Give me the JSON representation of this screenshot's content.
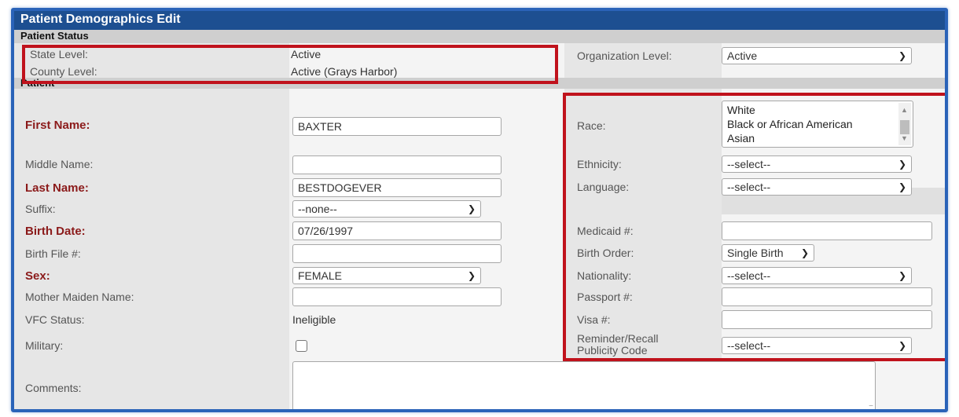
{
  "title": "Patient Demographics Edit",
  "status_section": {
    "header": "Patient Status",
    "state_level_label": "State Level:",
    "state_level_value": "Active",
    "county_level_label": "County Level:",
    "county_level_value": "Active (Grays Harbor)",
    "org_level_label": "Organization Level:",
    "org_level_value": "Active"
  },
  "patient_section": {
    "header": "Patient",
    "first_name_label": "First Name:",
    "first_name_value": "BAXTER",
    "middle_name_label": "Middle Name:",
    "middle_name_value": "",
    "last_name_label": "Last Name:",
    "last_name_value": "BESTDOGEVER",
    "suffix_label": "Suffix:",
    "suffix_value": "--none--",
    "birth_date_label": "Birth Date:",
    "birth_date_value": "07/26/1997",
    "birth_file_label": "Birth File #:",
    "birth_file_value": "",
    "sex_label": "Sex:",
    "sex_value": "FEMALE",
    "mother_maiden_label": "Mother Maiden Name:",
    "mother_maiden_value": "",
    "vfc_label": "VFC Status:",
    "vfc_value": "Ineligible",
    "military_label": "Military:",
    "comments_label": "Comments:",
    "comments_value": "",
    "race_label": "Race:",
    "race_options": [
      "White",
      "Black or African American",
      "Asian"
    ],
    "ethnicity_label": "Ethnicity:",
    "ethnicity_value": "--select--",
    "language_label": "Language:",
    "language_value": "--select--",
    "medicaid_label": "Medicaid #:",
    "medicaid_value": "",
    "birth_order_label": "Birth Order:",
    "birth_order_value": "Single Birth",
    "nationality_label": "Nationality:",
    "nationality_value": "--select--",
    "passport_label": "Passport #:",
    "passport_value": "",
    "visa_label": "Visa #:",
    "visa_value": "",
    "reminder_label_line1": "Reminder/Recall",
    "reminder_label_line2": "Publicity Code",
    "reminder_value": "--select--"
  },
  "colors": {
    "title_bg": "#1d4f91",
    "required_label": "#8b1a1a",
    "highlight_box": "#c0121c",
    "frame_border": "#2a63b8"
  }
}
